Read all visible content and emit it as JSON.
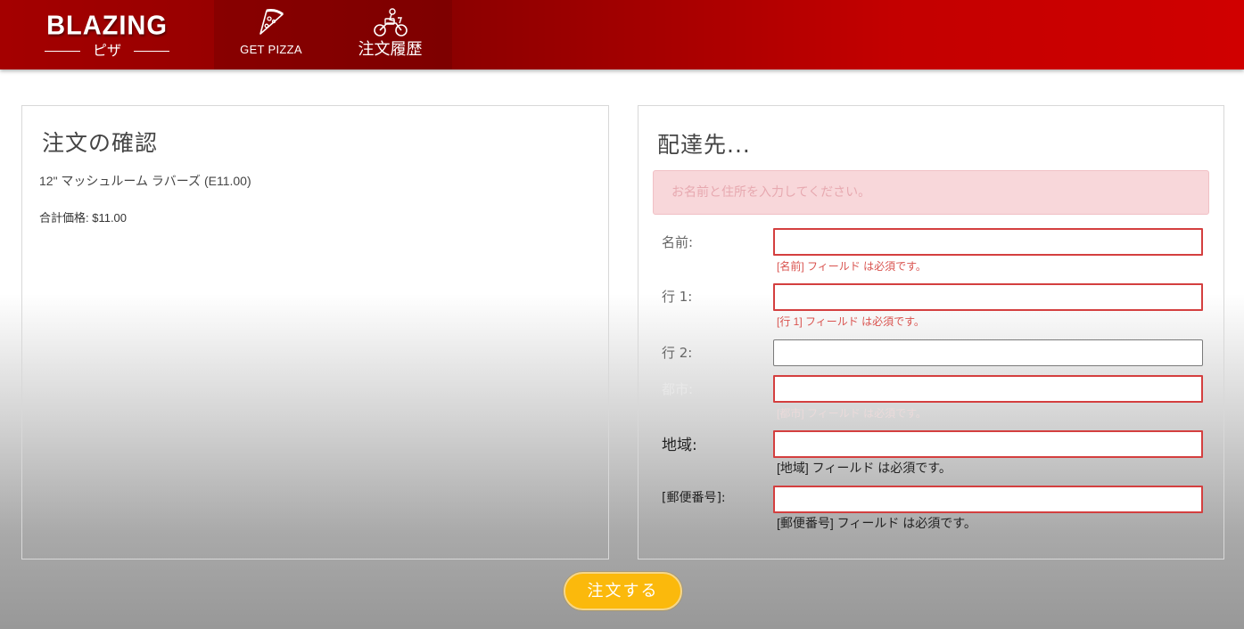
{
  "brand": {
    "name": "BLAZING",
    "sub": "ピザ"
  },
  "nav": {
    "get_pizza": "GET PIZZA",
    "orders": "注文履歴"
  },
  "order": {
    "title": "注文の確認",
    "item": "12\" マッシュルーム ラバーズ (E11.00)",
    "total": "合計価格: $11.00"
  },
  "delivery": {
    "title": "配達先...",
    "alert": "お名前と住所を入力してください。",
    "fields": [
      {
        "label": "名前:",
        "value": "",
        "error": "[名前] フィールド は必須です。"
      },
      {
        "label": "行 1:",
        "value": "",
        "error": "[行 1] フィールド は必須です。"
      },
      {
        "label": "行 2:",
        "value": "",
        "error": ""
      },
      {
        "label": "都市:",
        "value": "",
        "error": "[都市] フィールド は必須です。"
      },
      {
        "label": "地域:",
        "value": "",
        "error": "[地域] フィールド は必須です。"
      },
      {
        "label": "[郵便番号]:",
        "value": "",
        "error": "[郵便番号] フィールド は必須です。"
      }
    ]
  },
  "submit_label": "注文する",
  "colors": {
    "header_red": "#c30000",
    "error_red": "#d43f3f",
    "alert_bg": "#f8d7da",
    "button_yellow": "#fbb90c"
  }
}
